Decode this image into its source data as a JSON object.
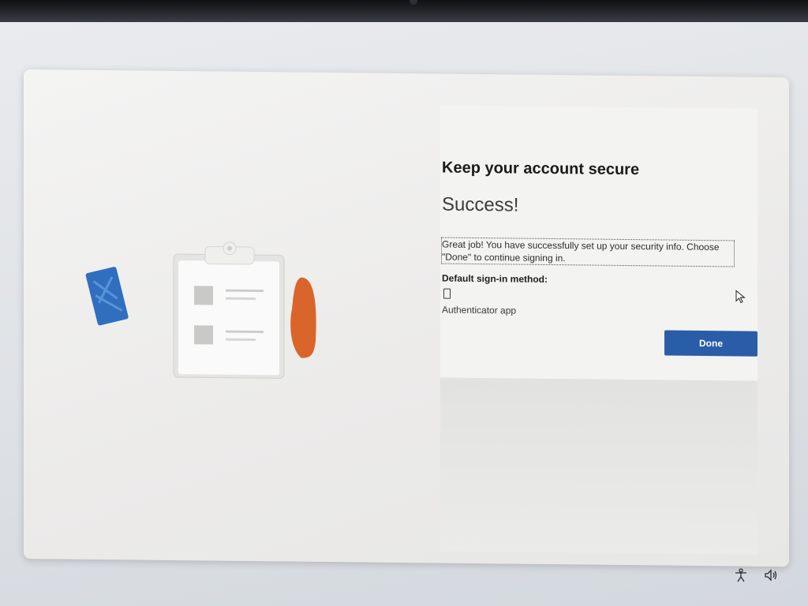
{
  "dialog": {
    "title": "Keep your account secure",
    "status": "Success!",
    "message": "Great job! You have successfully set up your security info. Choose \"Done\" to continue signing in.",
    "default_method_label": "Default sign-in method:",
    "default_method_icon": "phone-icon",
    "default_method_value": "Authenticator app",
    "done_label": "Done"
  },
  "tray": {
    "icons": [
      "accessibility-icon",
      "volume-icon"
    ]
  },
  "colors": {
    "accent": "#2a5da8",
    "illustration_blue": "#2f6fbe",
    "illustration_orange": "#d9652b"
  }
}
